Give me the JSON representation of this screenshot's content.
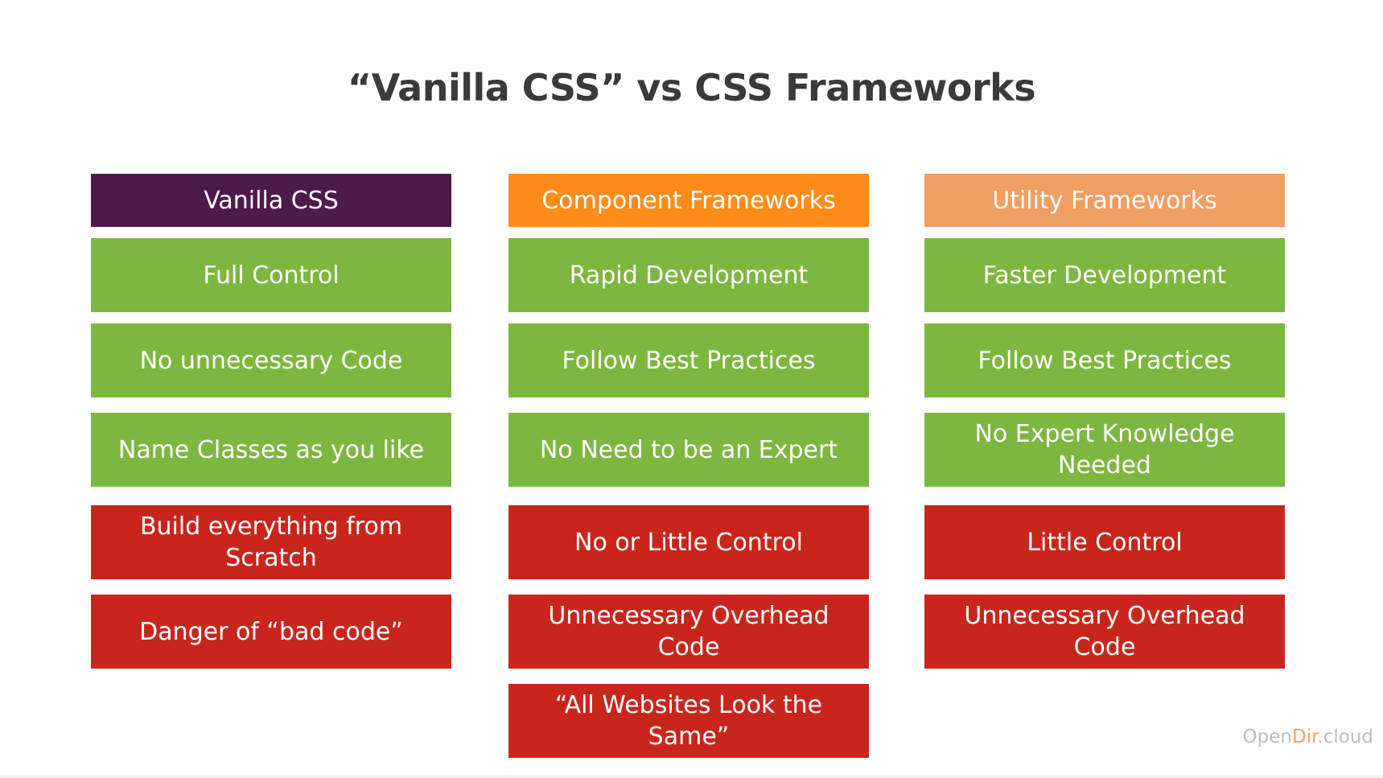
{
  "title": "“Vanilla CSS” vs CSS Frameworks",
  "colors": {
    "vanilla_header": "#4e1a4a",
    "component_header": "#ff8c1a",
    "utility_header": "#f09e62",
    "pro": "#7db740",
    "con": "#c8261d"
  },
  "columns": [
    {
      "header": "Vanilla CSS",
      "items": [
        {
          "text": "Full Control",
          "kind": "pro"
        },
        {
          "text": "No unnecessary Code",
          "kind": "pro"
        },
        {
          "text": "Name Classes as you like",
          "kind": "pro"
        },
        {
          "text": "Build everything from Scratch",
          "kind": "con"
        },
        {
          "text": "Danger of “bad code”",
          "kind": "con"
        }
      ]
    },
    {
      "header": "Component Frameworks",
      "items": [
        {
          "text": "Rapid Development",
          "kind": "pro"
        },
        {
          "text": "Follow Best Practices",
          "kind": "pro"
        },
        {
          "text": "No Need to be an Expert",
          "kind": "pro"
        },
        {
          "text": "No or Little Control",
          "kind": "con"
        },
        {
          "text": "Unnecessary Overhead Code",
          "kind": "con"
        },
        {
          "text": "“All Websites Look the Same”",
          "kind": "con"
        }
      ]
    },
    {
      "header": "Utility Frameworks",
      "items": [
        {
          "text": "Faster Development",
          "kind": "pro"
        },
        {
          "text": "Follow Best Practices",
          "kind": "pro"
        },
        {
          "text": "No Expert Knowledge Needed",
          "kind": "pro"
        },
        {
          "text": "Little Control",
          "kind": "con"
        },
        {
          "text": "Unnecessary Overhead Code",
          "kind": "con"
        }
      ]
    }
  ],
  "watermark": {
    "part1": "Open",
    "part2": "Dir",
    "part3": ".cloud"
  }
}
